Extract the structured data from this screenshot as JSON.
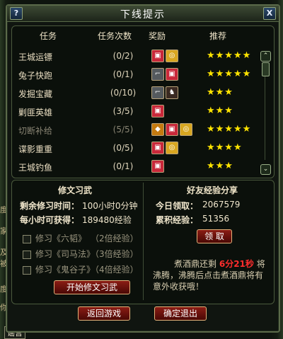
{
  "window": {
    "title": "下线提示",
    "help_label": "?",
    "close_label": "X"
  },
  "table": {
    "headers": {
      "task": "任务",
      "count": "任务次数",
      "reward": "奖励",
      "recommend": "推荐"
    },
    "rows": [
      {
        "name": "王城运镖",
        "count": "(0/2)",
        "rewards": [
          "red-gift-icon",
          "gold-coins-icon"
        ],
        "stars": "★★★★★",
        "dim": false
      },
      {
        "name": "兔子快跑",
        "count": "(0/1)",
        "rewards": [
          "gun-icon",
          "red-gift-icon"
        ],
        "stars": "★★★★★",
        "dim": false
      },
      {
        "name": "发掘宝藏",
        "count": "(0/10)",
        "rewards": [
          "gun-icon",
          "mount-icon"
        ],
        "stars": "★★★",
        "dim": false
      },
      {
        "name": "剿匪英雄",
        "count": "(3/5)",
        "rewards": [
          "red-gift-icon"
        ],
        "stars": "★★★",
        "dim": false
      },
      {
        "name": "切断补给",
        "count": "(5/5)",
        "rewards": [
          "money-bag-icon",
          "red-gift-icon",
          "gold-coins-icon"
        ],
        "stars": "★★★★★",
        "dim": true
      },
      {
        "name": "谍影重重",
        "count": "(0/5)",
        "rewards": [
          "red-gift-icon",
          "gold-coins-icon"
        ],
        "stars": "★★★★",
        "dim": false
      },
      {
        "name": "王城钓鱼",
        "count": "(0/1)",
        "rewards": [
          "red-gift-icon"
        ],
        "stars": "★★★",
        "dim": false
      }
    ]
  },
  "study": {
    "title": "修文习武",
    "remaining_label": "剩余修习时间：",
    "remaining_value": "100小时0分钟",
    "gain_label": "每小时可获得：",
    "gain_value": "189480经验",
    "options": [
      {
        "label": "修习《六韬》",
        "bonus": "（2倍经验）"
      },
      {
        "label": "修习《司马法》",
        "bonus": "（3倍经验）"
      },
      {
        "label": "修习《鬼谷子》",
        "bonus": "（4倍经验）"
      }
    ],
    "start_button": "开始修文习武"
  },
  "share": {
    "title": "好友经验分享",
    "today_label": "今日领取：",
    "today_value": "2067579",
    "total_label": "累积经验：",
    "total_value": "51356",
    "claim_button": "领 取",
    "notice_pre": "煮酒鼎还剩",
    "notice_time": "6分21秒",
    "notice_post": "将",
    "notice_line2": "沸腾，沸腾后点击煮酒鼎将有",
    "notice_line3": "意外收获哦！"
  },
  "footer": {
    "return_button": "返回游戏",
    "quit_button": "确定退出"
  },
  "colors": {
    "accent_red": "#8a1c14",
    "star_yellow": "#ffe400",
    "frame_green": "#5b6a4a"
  },
  "background": {
    "left_chars": [
      "度",
      "家",
      "皮",
      "及",
      "被",
      "度",
      "你"
    ],
    "bottom_left": "谣言"
  }
}
